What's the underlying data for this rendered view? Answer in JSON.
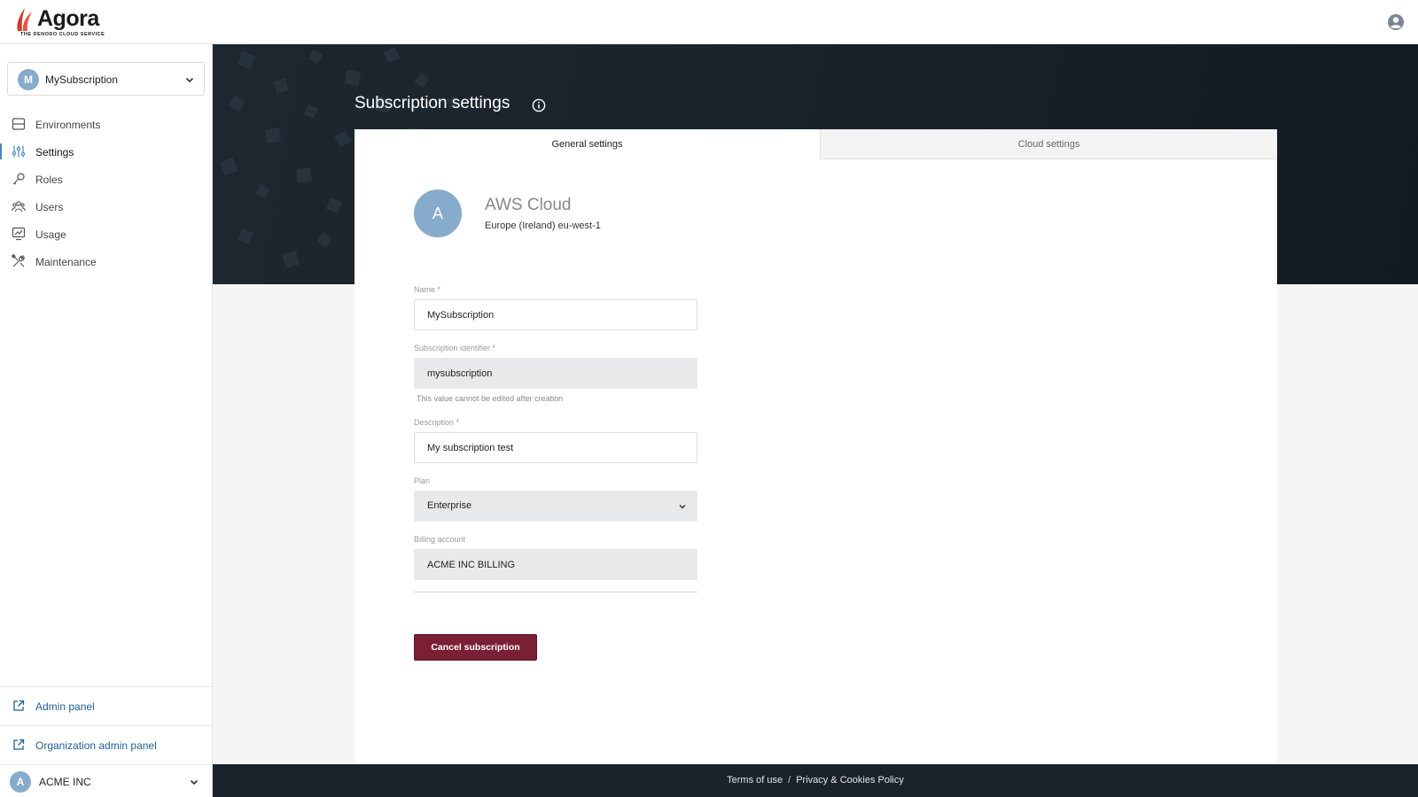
{
  "brand": {
    "name": "Agora",
    "tagline": "THE DENODO CLOUD SERVICE",
    "accent": "#d43a2a"
  },
  "header": {
    "user_icon": "user-circle-icon"
  },
  "sidebar": {
    "subscription": {
      "initial": "M",
      "name": "MySubscription"
    },
    "items": [
      {
        "label": "Environments",
        "icon": "server-icon"
      },
      {
        "label": "Settings",
        "icon": "sliders-icon",
        "active": true
      },
      {
        "label": "Roles",
        "icon": "key-icon"
      },
      {
        "label": "Users",
        "icon": "users-icon"
      },
      {
        "label": "Usage",
        "icon": "chart-icon"
      },
      {
        "label": "Maintenance",
        "icon": "tools-icon"
      }
    ],
    "admin_panel": "Admin panel",
    "org_admin_panel": "Organization admin panel",
    "organization": {
      "initial": "A",
      "name": "ACME INC"
    }
  },
  "page": {
    "title": "Subscription settings"
  },
  "tabs": [
    {
      "label": "General settings",
      "active": true
    },
    {
      "label": "Cloud settings",
      "active": false
    }
  ],
  "cloud": {
    "initial": "A",
    "name": "AWS Cloud",
    "region": "Europe (Ireland) eu-west-1"
  },
  "form": {
    "name": {
      "label": "Name *",
      "value": "MySubscription"
    },
    "identifier": {
      "label": "Subscription identifier *",
      "value": "mysubscription",
      "hint": "This value cannot be edited after creation"
    },
    "description": {
      "label": "Description *",
      "value": "My subscription test"
    },
    "plan": {
      "label": "Plan",
      "value": "Enterprise"
    },
    "billing": {
      "label": "Billing account",
      "value": "ACME INC BILLING"
    },
    "cancel_label": "Cancel subscription"
  },
  "footer": {
    "terms": "Terms of use",
    "separator": "/",
    "privacy": "Privacy & Cookies Policy"
  },
  "colors": {
    "sidebar_link": "#1e5f95",
    "avatar": "#86abcb",
    "danger": "#7a1f34",
    "hero_dark": "#1a232b"
  }
}
